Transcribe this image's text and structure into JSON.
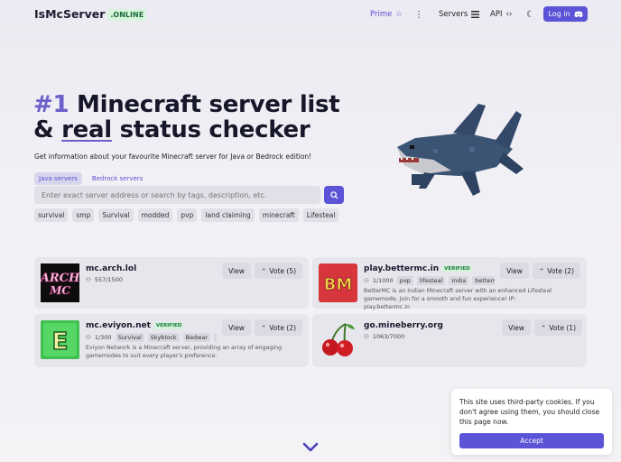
{
  "header": {
    "logo": "IsMcServer",
    "logo_badge": ".ONLINE",
    "nav": {
      "prime": "Prime",
      "servers": "Servers",
      "api": "API",
      "login": "Log in"
    }
  },
  "hero": {
    "title_accent": "#1",
    "title_part1": " Minecraft server list",
    "title_part2_prefix": "& ",
    "title_underline": "real",
    "title_part2_suffix": " status checker",
    "subtitle": "Get information about your favourite Minecraft server for Java or Bedrock edition!",
    "tabs": [
      {
        "label": "Java servers",
        "active": true
      },
      {
        "label": "Bedrock servers",
        "active": false
      }
    ],
    "search_placeholder": "Enter exact server address or search by tags, description, etc.",
    "tags": [
      "survival",
      "smp",
      "Survival",
      "modded",
      "pvp",
      "land claiming",
      "minecraft",
      "Lifesteal"
    ]
  },
  "servers": [
    {
      "name": "mc.arch.lol",
      "verified": false,
      "players": "557/1500",
      "tags": [],
      "description": "",
      "view": "View",
      "vote": "Vote (5)",
      "icon": "arch-mc-logo"
    },
    {
      "name": "play.bettermc.in",
      "verified": true,
      "verified_label": "VERIFIED",
      "players": "1/1000",
      "tags": [
        "pvp",
        "lifesteal",
        "india",
        "bettermc"
      ],
      "description": "BetterMC is an Indian Minecraft server with an enhanced Lifesteal gamemode. Join for a smooth and fun experience! IP: play.bettermc.in",
      "view": "View",
      "vote": "Vote (2)",
      "icon": "bm-logo"
    },
    {
      "name": "mc.eviyon.net",
      "verified": true,
      "verified_label": "VERIFIED",
      "players": "1/300",
      "tags": [
        "Survival",
        "Skyblock",
        "Bedwar",
        "Pr"
      ],
      "description": "Eviyon Network is a Minecraft server, providing an array of engaging gamemodes to suit every player's preference.",
      "view": "View",
      "vote": "Vote (2)",
      "icon": "eviyon-logo"
    },
    {
      "name": "go.mineberry.org",
      "verified": false,
      "players": "1063/7000",
      "tags": [],
      "description": "",
      "view": "View",
      "vote": "Vote (1)",
      "icon": "cherry-logo"
    }
  ],
  "cookie": {
    "text": "This site uses third-party cookies. If you don't agree using them, you should close this page now.",
    "accept": "Accept"
  },
  "colors": {
    "accent": "#5b54d6",
    "verified_green": "#1d7a3e"
  }
}
